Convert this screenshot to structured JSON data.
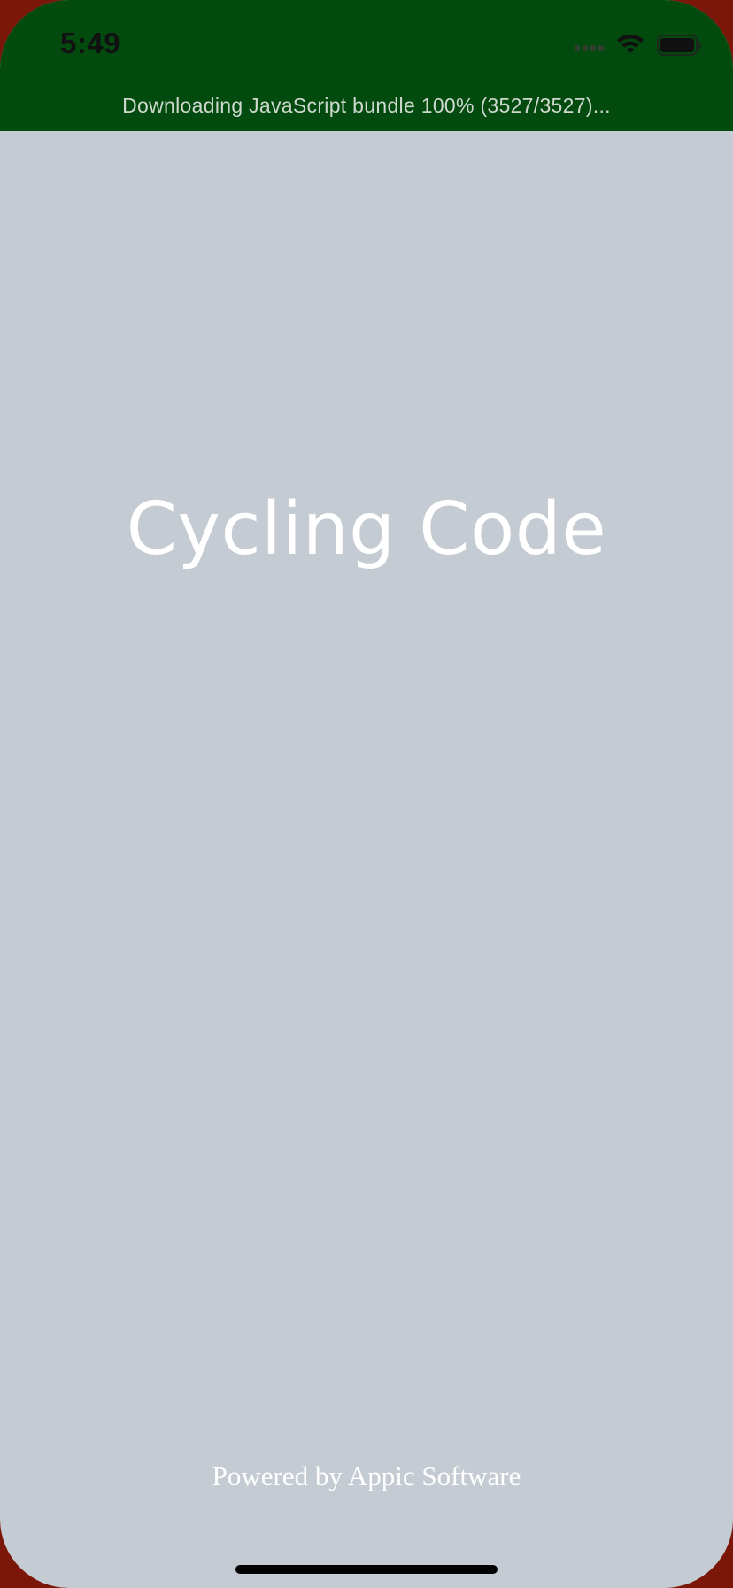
{
  "status_bar": {
    "time": "5:49"
  },
  "banner": {
    "message": "Downloading JavaScript bundle 100% (3527/3527)...",
    "progress_percent": 100,
    "color": "#024a0e"
  },
  "splash": {
    "title": "Cycling Code",
    "footer": "Powered by Appic Software",
    "background": "#c5cbd2"
  },
  "icons": {
    "signal": "cellular-signal-icon",
    "wifi": "wifi-icon",
    "battery": "battery-icon"
  }
}
